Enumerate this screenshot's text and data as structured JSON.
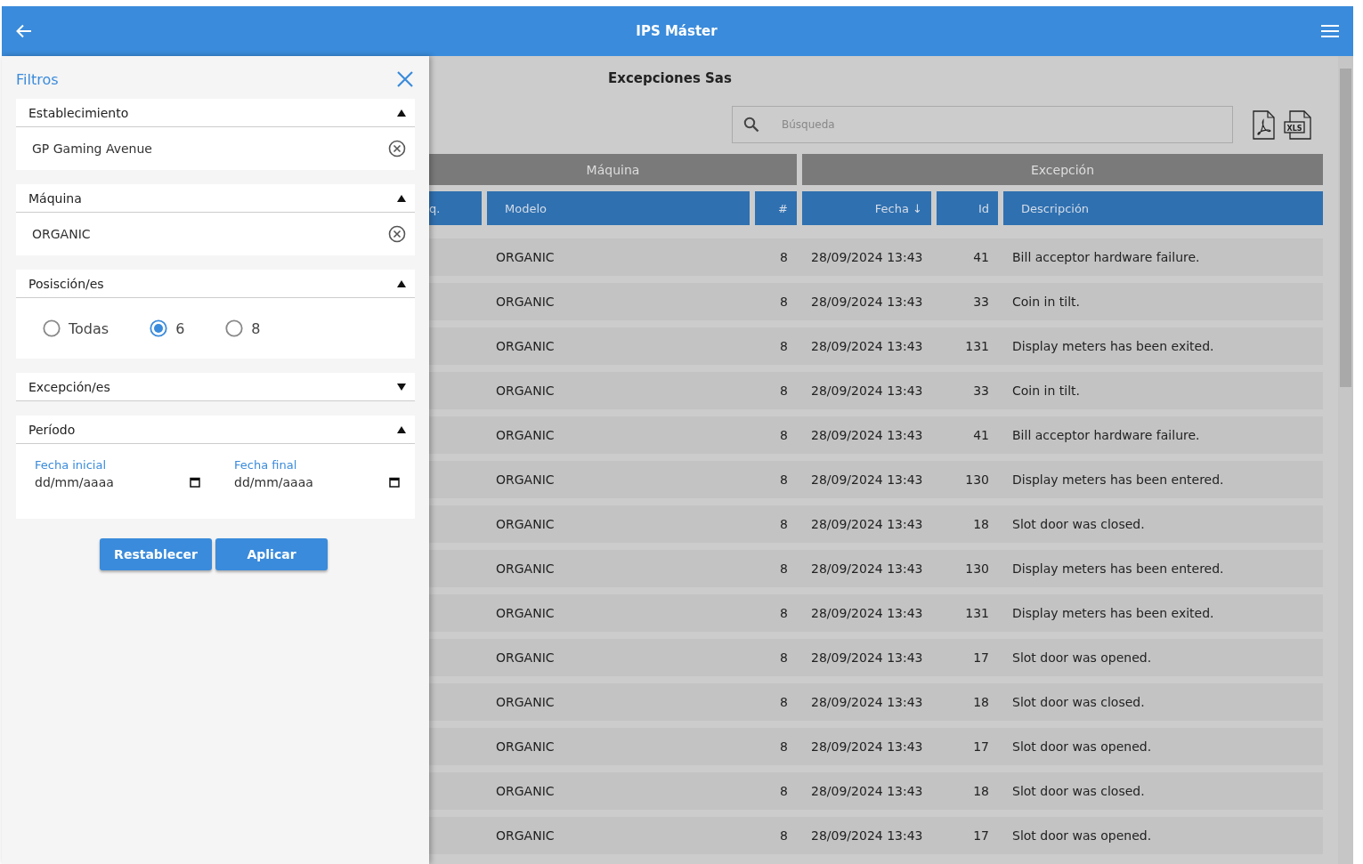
{
  "app_bar": {
    "title": "IPS Máster"
  },
  "filters": {
    "title": "Filtros",
    "sections": [
      {
        "kind": "select",
        "title": "Establecimiento",
        "expanded": true,
        "value": "GP Gaming Avenue"
      },
      {
        "kind": "select",
        "title": "Máquina",
        "expanded": true,
        "value": "ORGANIC"
      },
      {
        "kind": "radio",
        "title": "Posisción/es",
        "expanded": true,
        "options": [
          {
            "label": "Todas",
            "selected": false
          },
          {
            "label": "6",
            "selected": true
          },
          {
            "label": "8",
            "selected": false
          }
        ]
      },
      {
        "kind": "select",
        "title": "Excepción/es",
        "expanded": false
      },
      {
        "kind": "dates",
        "title": "Período",
        "expanded": true,
        "fields": [
          {
            "label": "Fecha inicial",
            "placeholder": "dd/mm/aaaa"
          },
          {
            "label": "Fecha final",
            "placeholder": "dd/mm/aaaa"
          }
        ]
      }
    ],
    "buttons": [
      "Restablecer",
      "Aplicar"
    ]
  },
  "page": {
    "title": "Excepciones Sas",
    "search": {
      "placeholder": "Búsqueda"
    },
    "xls_label": "XLS"
  },
  "table": {
    "groups": [
      "Máquina",
      "Excepción"
    ],
    "columns": [
      "q.",
      "Modelo",
      "#",
      "Fecha ↓",
      "Id",
      "Descripción"
    ],
    "rows": [
      [
        "",
        "ORGANIC",
        "8",
        "28/09/2024 13:43",
        "41",
        "Bill acceptor hardware failure."
      ],
      [
        "",
        "ORGANIC",
        "8",
        "28/09/2024 13:43",
        "33",
        "Coin in tilt."
      ],
      [
        "",
        "ORGANIC",
        "8",
        "28/09/2024 13:43",
        "131",
        "Display meters has been exited."
      ],
      [
        "",
        "ORGANIC",
        "8",
        "28/09/2024 13:43",
        "33",
        "Coin in tilt."
      ],
      [
        "",
        "ORGANIC",
        "8",
        "28/09/2024 13:43",
        "41",
        "Bill acceptor hardware failure."
      ],
      [
        "",
        "ORGANIC",
        "8",
        "28/09/2024 13:43",
        "130",
        "Display meters has been entered."
      ],
      [
        "",
        "ORGANIC",
        "8",
        "28/09/2024 13:43",
        "18",
        "Slot door was closed."
      ],
      [
        "",
        "ORGANIC",
        "8",
        "28/09/2024 13:43",
        "130",
        "Display meters has been entered."
      ],
      [
        "",
        "ORGANIC",
        "8",
        "28/09/2024 13:43",
        "131",
        "Display meters has been exited."
      ],
      [
        "",
        "ORGANIC",
        "8",
        "28/09/2024 13:43",
        "17",
        "Slot door was opened."
      ],
      [
        "",
        "ORGANIC",
        "8",
        "28/09/2024 13:43",
        "18",
        "Slot door was closed."
      ],
      [
        "",
        "ORGANIC",
        "8",
        "28/09/2024 13:43",
        "17",
        "Slot door was opened."
      ],
      [
        "",
        "ORGANIC",
        "8",
        "28/09/2024 13:43",
        "18",
        "Slot door was closed."
      ],
      [
        "",
        "ORGANIC",
        "8",
        "28/09/2024 13:43",
        "17",
        "Slot door was opened."
      ]
    ]
  }
}
